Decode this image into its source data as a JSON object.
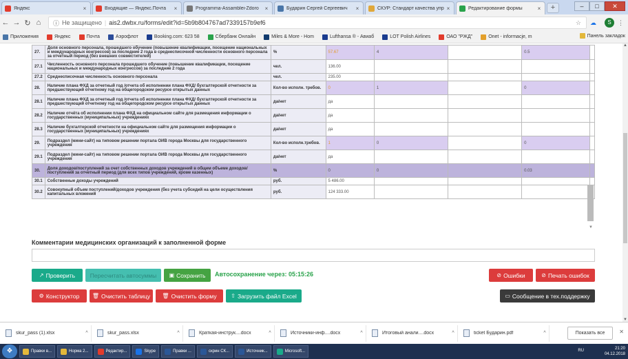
{
  "browser": {
    "tabs": [
      {
        "title": "Яндекс",
        "icon": "yandex-icon",
        "color": "#e23b2c"
      },
      {
        "title": "Входящие — Яндекс.Почта",
        "icon": "mail-icon",
        "color": "#e23b2c"
      },
      {
        "title": "Programma-Assamblei-Zdoro",
        "icon": "doc-icon",
        "color": "#777"
      },
      {
        "title": "Бударин Сергей Сергеевич",
        "icon": "vk-icon",
        "color": "#4a76a8"
      },
      {
        "title": "СКУР: Стандарт качества упр",
        "icon": "doc-icon",
        "color": "#e0a83b"
      },
      {
        "title": "Редактирование формы",
        "icon": "form-icon",
        "color": "#2aa34b",
        "active": true
      }
    ],
    "address": {
      "security": "Не защищено",
      "url": "ais2.dwbx.ru/forms/edit?id=5b9b804767ad7339157b9ef6"
    },
    "bookmarks": [
      {
        "label": "Приложения",
        "color": "#4a76a8"
      },
      {
        "label": "Яндекс",
        "color": "#e23b2c"
      },
      {
        "label": "Почта",
        "color": "#e23b2c"
      },
      {
        "label": "Аэрофлот",
        "color": "#2b4c9a"
      },
      {
        "label": "Booking.com: 623 58",
        "color": "#1a3c8f"
      },
      {
        "label": "Сбербанк Онлайн",
        "color": "#2aa34b"
      },
      {
        "label": "Miles & More - Hom",
        "color": "#123b6e"
      },
      {
        "label": "Lufthansa ® - Авиаб",
        "color": "#1a3c8f"
      },
      {
        "label": "LOT Polish Airlines",
        "color": "#1a3c8f"
      },
      {
        "label": "ОАО \"РЖД\"",
        "color": "#e23b2c"
      },
      {
        "label": "Onet - informacje, m",
        "color": "#e3a02c"
      }
    ],
    "bookmarks_right": "Панель закладок"
  },
  "table": {
    "rows": [
      {
        "num": "27.",
        "name": "Доля основного персонала, прошедшего обучение (повышение квалификации, посещение национальных и международных конгрессов) за последние 2 года в среднесписочной численности основного персонала за отчетный период (без внешних совместителей)",
        "unit": "%",
        "v1": "57.67",
        "v2": "4",
        "v3": "",
        "v4": "0.5",
        "v5": "",
        "style": "lav"
      },
      {
        "num": "27.1",
        "name": "Численность основного персонала прошедшего обучение (повышение квалификации, посещение национальных и международных конгрессов) за последние 2 года",
        "unit": "чел.",
        "v1": "136.00",
        "v2": "",
        "v3": "",
        "v4": "",
        "v5": "",
        "style": ""
      },
      {
        "num": "27.2",
        "name": "Среднесписочная численность основного персонала",
        "unit": "чел.",
        "v1": "235.00",
        "v2": "",
        "v3": "",
        "v4": "",
        "v5": "",
        "style": "short"
      },
      {
        "num": "28.",
        "name": "Наличие плана ФХД за отчетный год /отчета об исполнении плана ФХД/ бухгалтерской отчетности за предшествующий отчетному год на общегородском ресурсе открытых данных",
        "unit": "Кол-во исполн. требов.",
        "v1": "0",
        "v2": "1",
        "v3": "",
        "v4": "0",
        "v5": "",
        "style": "lav"
      },
      {
        "num": "28.1",
        "name": "Наличие плана ФХД за отчетный год /отчета об исполнении плана ФХД/ бухгалтерской отчетности за предшествующий отчетному год на общегородском ресурсе открытых данных",
        "unit": "да/нет",
        "v1": "да",
        "v2": "",
        "v3": "",
        "v4": "",
        "v5": "",
        "style": ""
      },
      {
        "num": "28.2",
        "name": "Наличие отчёта об исполнении плана ФХД на официальном сайте для размещения информации о государственных (муниципальных) учреждениях",
        "unit": "да/нет",
        "v1": "да",
        "v2": "",
        "v3": "",
        "v4": "",
        "v5": "",
        "style": ""
      },
      {
        "num": "28.3",
        "name": "Наличие бухгалтерской отчетности на официальном сайте для размещения информации о государственных (муниципальных) учреждениях",
        "unit": "да/нет",
        "v1": "да",
        "v2": "",
        "v3": "",
        "v4": "",
        "v5": "",
        "style": ""
      },
      {
        "num": "29.",
        "name": "Подраздел (мини-сайт) на типовом решении портала ОИВ города Москвы для государственного учреждения",
        "unit": "Кол-во исполн.требов.",
        "v1": "1",
        "v2": "0",
        "v3": "",
        "v4": "0",
        "v5": "",
        "style": "lav"
      },
      {
        "num": "29.1",
        "name": "Подраздел (мини-сайт) на типовом решении портала ОИВ города Москвы для государственного учреждения",
        "unit": "да/нет",
        "v1": "да",
        "v2": "",
        "v3": "",
        "v4": "",
        "v5": "",
        "style": ""
      },
      {
        "num": "30.",
        "name": "Доля доходов/поступлений за счет собственных доходов учреждений в общем объеме доходов/ поступлений за отчетный период (для всех типов учреждений, кроме казенных)",
        "unit": "%",
        "v1": "0",
        "v2": "0",
        "v3": "",
        "v4": "0.03",
        "v5": "",
        "style": "purple"
      },
      {
        "num": "30.1",
        "name": "Собственные доходы учреждений",
        "unit": "руб.",
        "v1": "5 486.00",
        "v2": "",
        "v3": "",
        "v4": "",
        "v5": "",
        "style": "short"
      },
      {
        "num": "30.2",
        "name": "Совокупный объем поступлений/доходов учреждения (без учета субсидий на цели осуществления капитальных вложений",
        "unit": "руб.",
        "v1": "124 333.00",
        "v2": "",
        "v3": "",
        "v4": "",
        "v5": "",
        "style": ""
      }
    ]
  },
  "comments": {
    "label": "Комментарии медицинских организаций к заполненной форме",
    "value": ""
  },
  "actions": {
    "check": "Проверить",
    "recalc": "Пересчитать автосуммы",
    "save": "Сохранить",
    "autosave": "Автосохранение через: 05:15:26",
    "errors": "Ошибки",
    "print_errors": "Печать ошибок",
    "constructor": "Конструктор",
    "clear_table": "Очистить таблицу",
    "clear_form": "Очистить форму",
    "upload_excel": "Загрузить файл Excel",
    "support": "Сообщение в тех.поддержку"
  },
  "downloads": {
    "items": [
      "skur_pass (1).xlsx",
      "skur_pass.xlsx",
      "Краткая-инструк....docx",
      "Источники-инф....docx",
      "Итоговый анали....docx",
      "ticket Бударин.pdf"
    ],
    "show_all": "Показать все"
  },
  "taskbar": {
    "items": [
      "Правки в...",
      "Норма 2...",
      "Редактир...",
      "Skype",
      "Правки ...",
      "скрин СК...",
      "Источник...",
      "Microsoft..."
    ],
    "time": "21:20",
    "date": "04.12.2018",
    "lang": "RU"
  }
}
